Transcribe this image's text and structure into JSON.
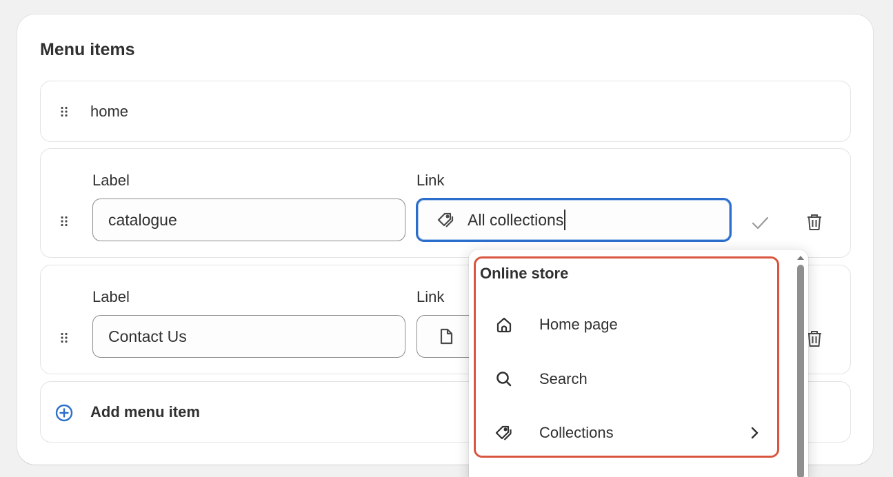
{
  "card": {
    "title": "Menu items"
  },
  "items": [
    {
      "label": "home"
    },
    {
      "label_heading": "Label",
      "link_heading": "Link",
      "label_value": "catalogue",
      "link_value": "All collections"
    },
    {
      "label_heading": "Label",
      "link_heading": "Link",
      "label_value": "Contact Us"
    }
  ],
  "add_item": {
    "label": "Add menu item"
  },
  "popover": {
    "section_title": "Online store",
    "options": [
      {
        "label": "Home page",
        "icon": "home-icon"
      },
      {
        "label": "Search",
        "icon": "search-icon"
      },
      {
        "label": "Collections",
        "icon": "tag-icon",
        "has_submenu": true
      }
    ]
  },
  "colors": {
    "focus_blue": "#2c6ecb",
    "highlight_red": "#d9553f",
    "add_icon_blue": "#2c6ecb"
  }
}
